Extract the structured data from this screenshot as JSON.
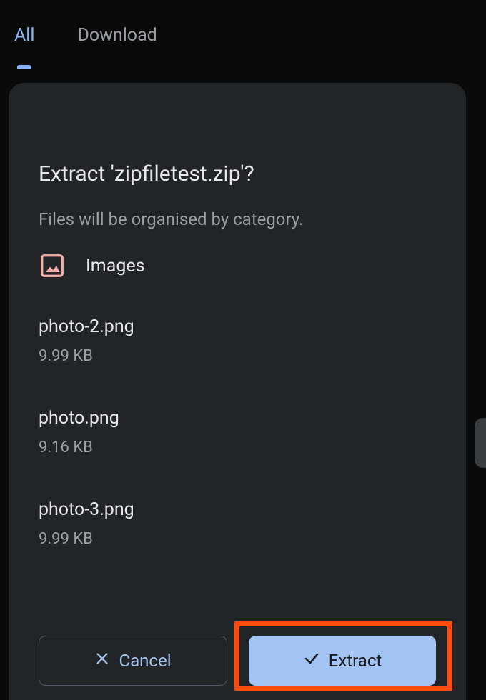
{
  "tabs": {
    "all": "All",
    "download": "Download"
  },
  "dialog": {
    "title": "Extract 'zipfiletest.zip'?",
    "subtitle": "Files will be organised by category.",
    "category_label": "Images",
    "files": [
      {
        "name": "photo-2.png",
        "size": "9.99 KB"
      },
      {
        "name": "photo.png",
        "size": "9.16 KB"
      },
      {
        "name": "photo-3.png",
        "size": "9.99 KB"
      }
    ],
    "cancel_label": "Cancel",
    "extract_label": "Extract"
  }
}
